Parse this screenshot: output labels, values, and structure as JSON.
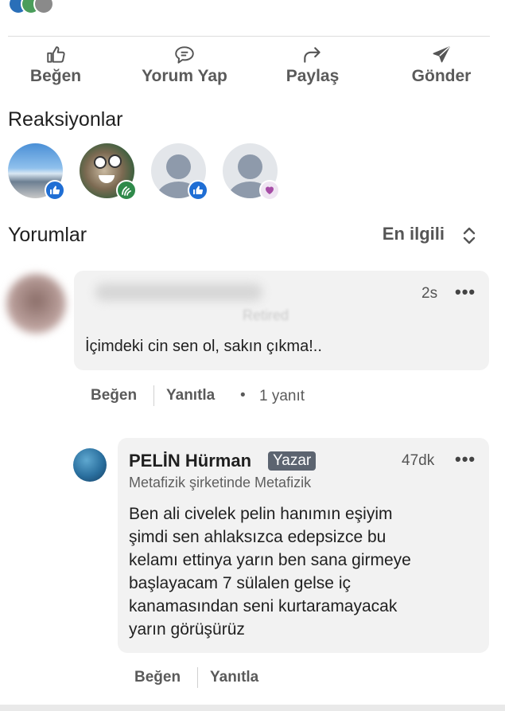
{
  "colors": {
    "like": "#1f6ed4",
    "celebrate": "#2f8a4a",
    "love": "#a64ca6",
    "badge_bg": "#5c6470"
  },
  "actions": [
    {
      "icon": "thumbs-up-icon",
      "label": "Beğen"
    },
    {
      "icon": "comment-icon",
      "label": "Yorum Yap"
    },
    {
      "icon": "share-arrow-icon",
      "label": "Paylaş"
    },
    {
      "icon": "send-icon",
      "label": "Gönder"
    }
  ],
  "reactions": {
    "title": "Reaksiyonlar",
    "items": [
      {
        "avatar": "landscape-photo",
        "reaction": "like"
      },
      {
        "avatar": "cartoon-squirrel",
        "reaction": "celebrate"
      },
      {
        "avatar": "default-person",
        "reaction": "like"
      },
      {
        "avatar": "default-person",
        "reaction": "love"
      }
    ]
  },
  "comments_section": {
    "title": "Yorumlar",
    "sort_label": "En ilgili",
    "comments": [
      {
        "author_blurred": true,
        "subtitle_blurred": "Retired",
        "time": "2s",
        "text": "İçimdeki cin sen ol, sakın çıkma!..",
        "like_label": "Beğen",
        "reply_label": "Yanıtla",
        "reply_count": "1 yanıt"
      }
    ],
    "reply": {
      "author": "PELİN Hürman",
      "badge": "Yazar",
      "headline": "Metafizik şirketinde Metafizik",
      "time": "47dk",
      "lines": [
        "Ben ali civelek pelin hanımın eşiyim",
        "şimdi sen ahlaksızca edepsizce bu",
        "kelamı ettinya yarın ben sana girmeye",
        "başlayacam 7 sülalen gelse iç",
        "kanamasından seni kurtaramayacak",
        "yarın görüşürüz"
      ],
      "like_label": "Beğen",
      "reply_label": "Yanıtla"
    }
  }
}
